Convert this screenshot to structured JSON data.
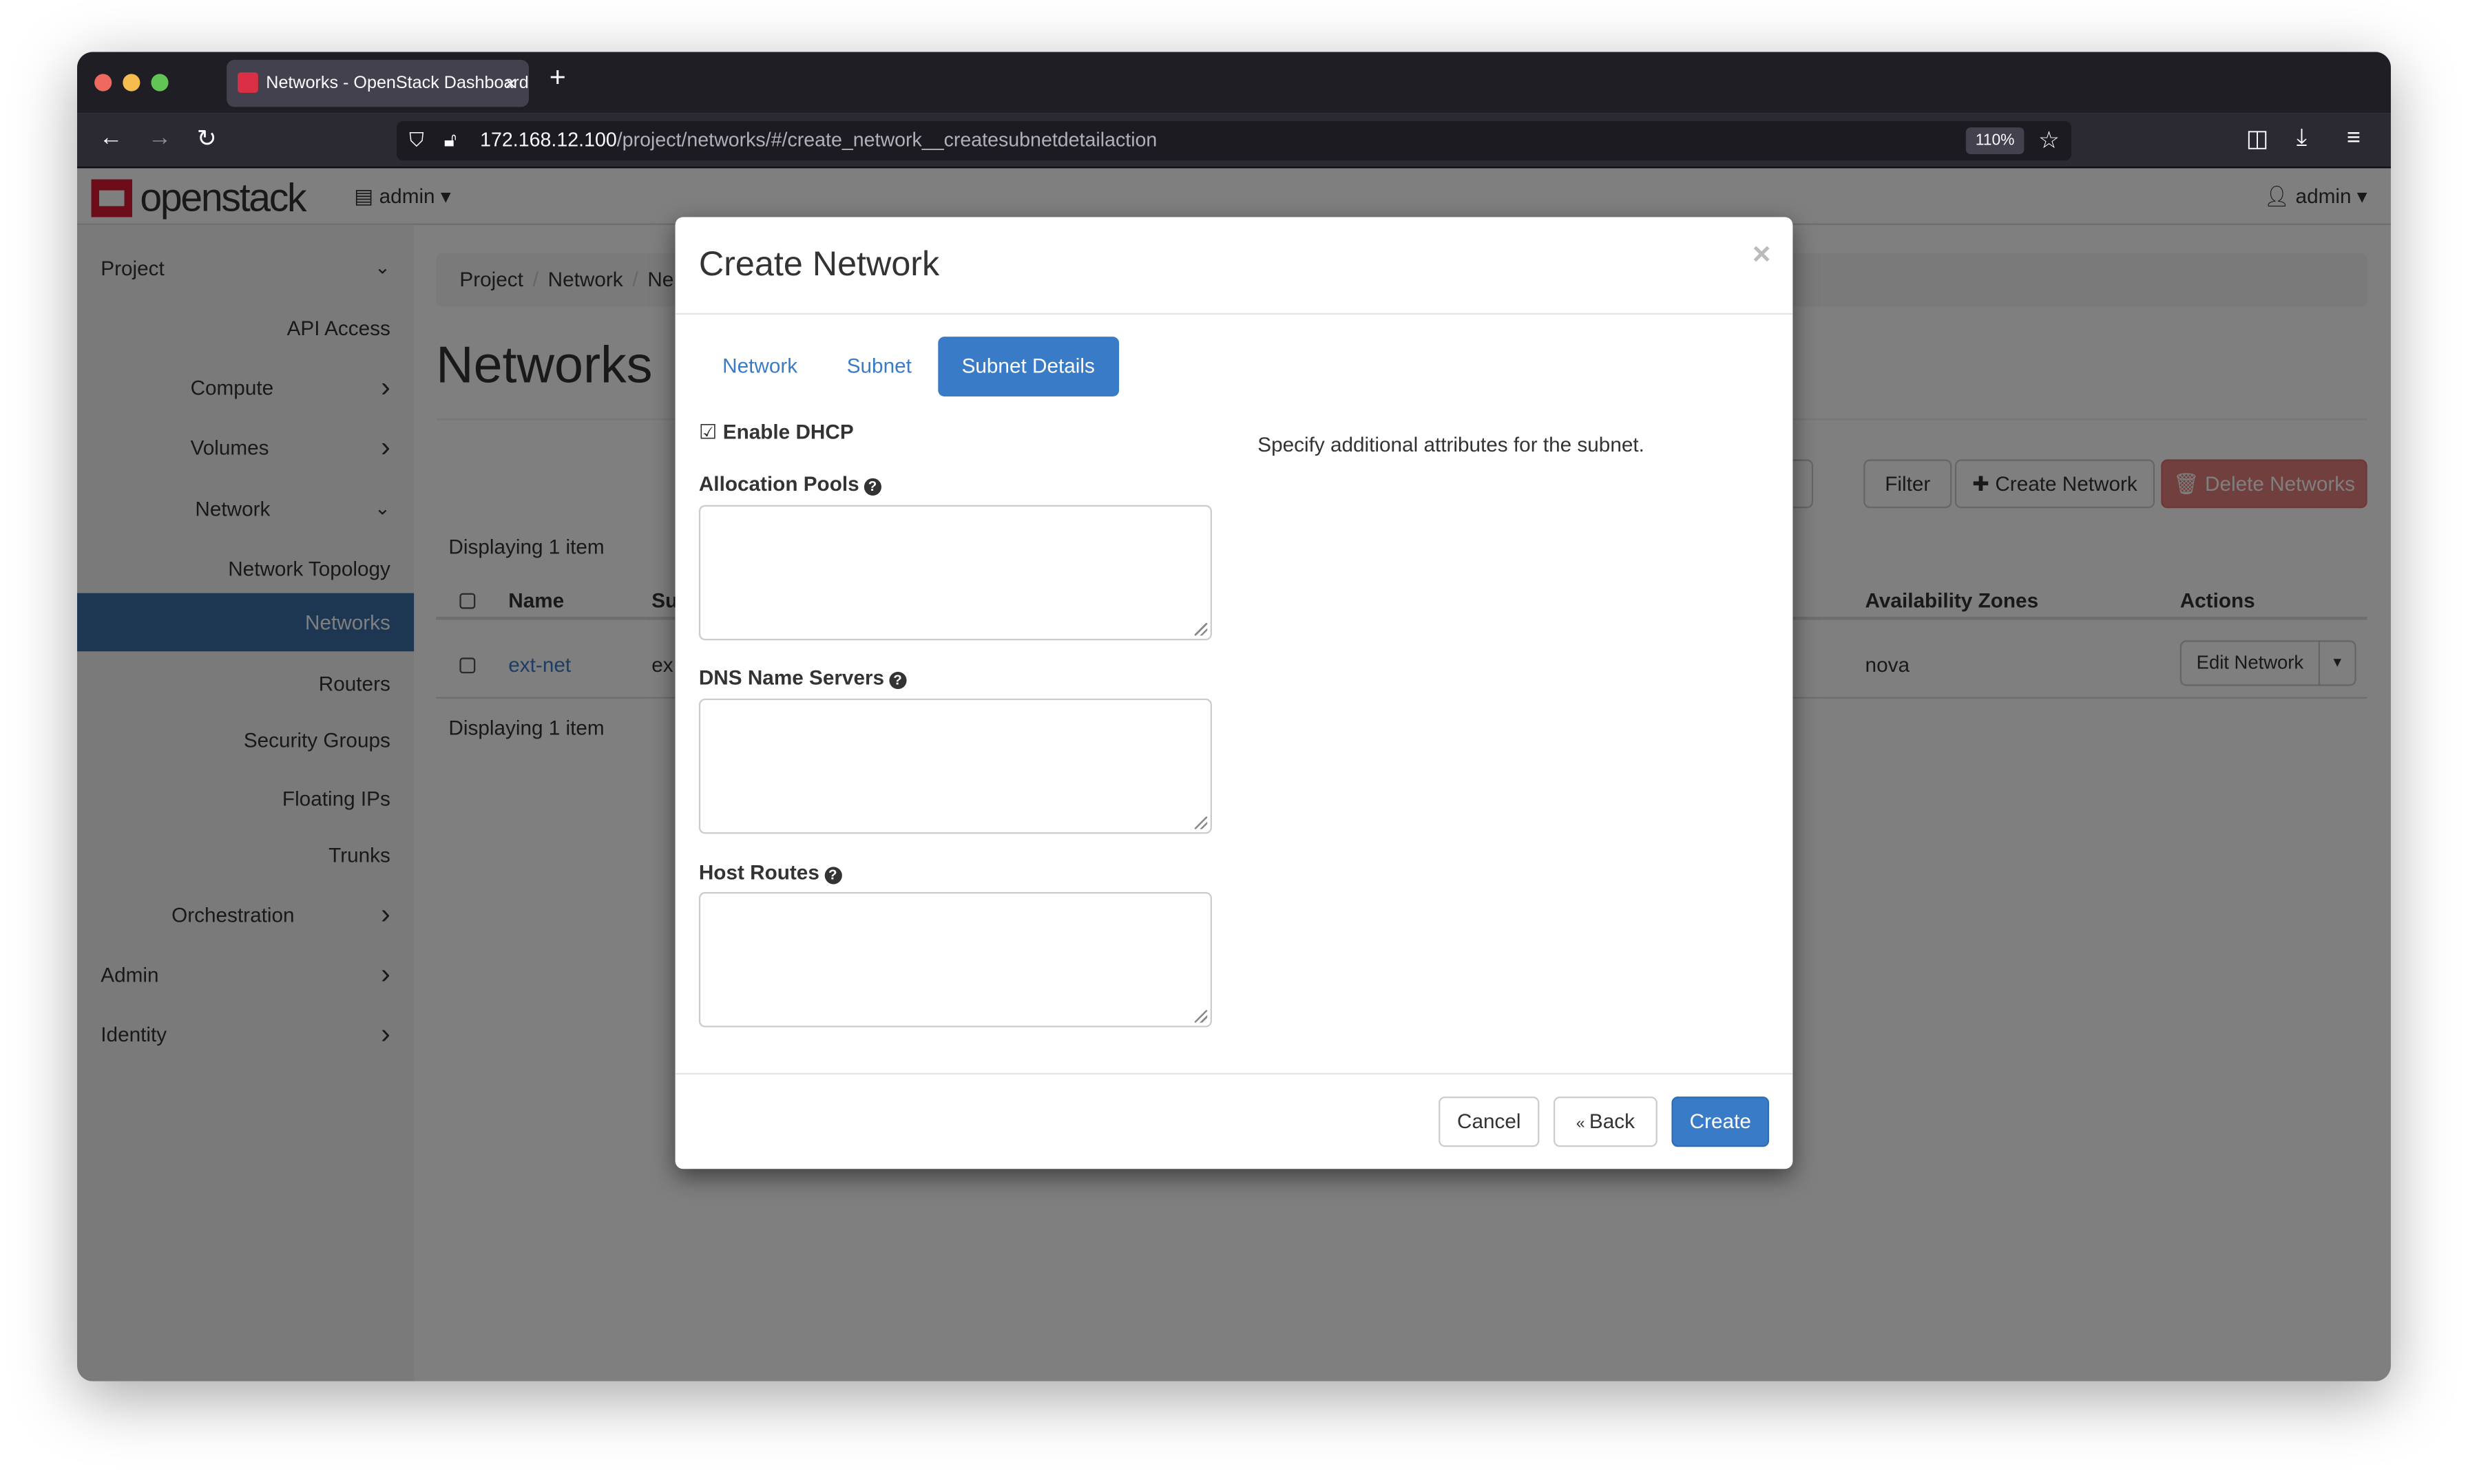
{
  "browser": {
    "tab_title": "Networks - OpenStack Dashboard",
    "new_tab": "+",
    "url_host": "172.168.12.100",
    "url_path": "/project/networks/#/create_network__createsubnetdetailaction",
    "zoom": "110%"
  },
  "header": {
    "logo": "openstack",
    "project": "admin",
    "user": "admin"
  },
  "sidebar": {
    "items": [
      {
        "label": "Project",
        "level": "top",
        "chevron": "down"
      },
      {
        "label": "API Access",
        "level": "sub"
      },
      {
        "label": "Compute",
        "level": "mid",
        "chevron": "right"
      },
      {
        "label": "Volumes",
        "level": "mid",
        "chevron": "right"
      },
      {
        "label": "Network",
        "level": "mid",
        "chevron": "down"
      },
      {
        "label": "Network Topology",
        "level": "sub"
      },
      {
        "label": "Networks",
        "level": "sub",
        "active": true
      },
      {
        "label": "Routers",
        "level": "sub"
      },
      {
        "label": "Security Groups",
        "level": "sub"
      },
      {
        "label": "Floating IPs",
        "level": "sub"
      },
      {
        "label": "Trunks",
        "level": "sub"
      },
      {
        "label": "Orchestration",
        "level": "mid",
        "chevron": "right"
      },
      {
        "label": "Admin",
        "level": "top",
        "chevron": "right"
      },
      {
        "label": "Identity",
        "level": "top",
        "chevron": "right"
      }
    ]
  },
  "main": {
    "breadcrumb": [
      "Project",
      "Network",
      "Ne"
    ],
    "title": "Networks",
    "filter_label": "Filter",
    "create_label": "Create Network",
    "delete_label": "Delete Networks",
    "displaying": "Displaying 1 item",
    "columns": {
      "name": "Name",
      "subnets": "Su",
      "az": "Availability Zones",
      "actions": "Actions"
    },
    "row": {
      "name": "ext-net",
      "subnets": "ex",
      "az": "nova",
      "action": "Edit Network"
    }
  },
  "modal": {
    "title": "Create Network",
    "close": "×",
    "tabs": [
      "Network",
      "Subnet",
      "Subnet Details"
    ],
    "active_tab": "Subnet Details",
    "enable_dhcp": {
      "label": "Enable DHCP",
      "checked": true
    },
    "fields": [
      {
        "label": "Allocation Pools",
        "value": ""
      },
      {
        "label": "DNS Name Servers",
        "value": ""
      },
      {
        "label": "Host Routes",
        "value": ""
      }
    ],
    "help": "Specify additional attributes for the subnet.",
    "cancel": "Cancel",
    "back": "Back",
    "create": "Create"
  },
  "colors": {
    "accent": "#3a7bc8",
    "sidebar_active": "#3a6ea5",
    "danger": "#d9534f",
    "brand": "#da1a32"
  }
}
